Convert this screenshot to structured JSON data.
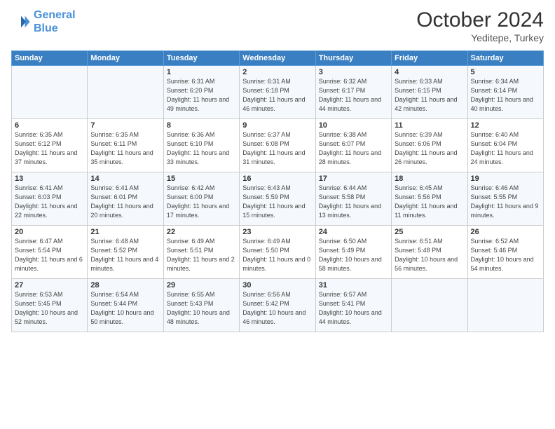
{
  "logo": {
    "line1": "General",
    "line2": "Blue"
  },
  "title": "October 2024",
  "location": "Yeditepe, Turkey",
  "days_header": [
    "Sunday",
    "Monday",
    "Tuesday",
    "Wednesday",
    "Thursday",
    "Friday",
    "Saturday"
  ],
  "weeks": [
    [
      {
        "num": "",
        "info": ""
      },
      {
        "num": "",
        "info": ""
      },
      {
        "num": "1",
        "info": "Sunrise: 6:31 AM\nSunset: 6:20 PM\nDaylight: 11 hours\nand 49 minutes."
      },
      {
        "num": "2",
        "info": "Sunrise: 6:31 AM\nSunset: 6:18 PM\nDaylight: 11 hours\nand 46 minutes."
      },
      {
        "num": "3",
        "info": "Sunrise: 6:32 AM\nSunset: 6:17 PM\nDaylight: 11 hours\nand 44 minutes."
      },
      {
        "num": "4",
        "info": "Sunrise: 6:33 AM\nSunset: 6:15 PM\nDaylight: 11 hours\nand 42 minutes."
      },
      {
        "num": "5",
        "info": "Sunrise: 6:34 AM\nSunset: 6:14 PM\nDaylight: 11 hours\nand 40 minutes."
      }
    ],
    [
      {
        "num": "6",
        "info": "Sunrise: 6:35 AM\nSunset: 6:12 PM\nDaylight: 11 hours\nand 37 minutes."
      },
      {
        "num": "7",
        "info": "Sunrise: 6:35 AM\nSunset: 6:11 PM\nDaylight: 11 hours\nand 35 minutes."
      },
      {
        "num": "8",
        "info": "Sunrise: 6:36 AM\nSunset: 6:10 PM\nDaylight: 11 hours\nand 33 minutes."
      },
      {
        "num": "9",
        "info": "Sunrise: 6:37 AM\nSunset: 6:08 PM\nDaylight: 11 hours\nand 31 minutes."
      },
      {
        "num": "10",
        "info": "Sunrise: 6:38 AM\nSunset: 6:07 PM\nDaylight: 11 hours\nand 28 minutes."
      },
      {
        "num": "11",
        "info": "Sunrise: 6:39 AM\nSunset: 6:06 PM\nDaylight: 11 hours\nand 26 minutes."
      },
      {
        "num": "12",
        "info": "Sunrise: 6:40 AM\nSunset: 6:04 PM\nDaylight: 11 hours\nand 24 minutes."
      }
    ],
    [
      {
        "num": "13",
        "info": "Sunrise: 6:41 AM\nSunset: 6:03 PM\nDaylight: 11 hours\nand 22 minutes."
      },
      {
        "num": "14",
        "info": "Sunrise: 6:41 AM\nSunset: 6:01 PM\nDaylight: 11 hours\nand 20 minutes."
      },
      {
        "num": "15",
        "info": "Sunrise: 6:42 AM\nSunset: 6:00 PM\nDaylight: 11 hours\nand 17 minutes."
      },
      {
        "num": "16",
        "info": "Sunrise: 6:43 AM\nSunset: 5:59 PM\nDaylight: 11 hours\nand 15 minutes."
      },
      {
        "num": "17",
        "info": "Sunrise: 6:44 AM\nSunset: 5:58 PM\nDaylight: 11 hours\nand 13 minutes."
      },
      {
        "num": "18",
        "info": "Sunrise: 6:45 AM\nSunset: 5:56 PM\nDaylight: 11 hours\nand 11 minutes."
      },
      {
        "num": "19",
        "info": "Sunrise: 6:46 AM\nSunset: 5:55 PM\nDaylight: 11 hours\nand 9 minutes."
      }
    ],
    [
      {
        "num": "20",
        "info": "Sunrise: 6:47 AM\nSunset: 5:54 PM\nDaylight: 11 hours\nand 6 minutes."
      },
      {
        "num": "21",
        "info": "Sunrise: 6:48 AM\nSunset: 5:52 PM\nDaylight: 11 hours\nand 4 minutes."
      },
      {
        "num": "22",
        "info": "Sunrise: 6:49 AM\nSunset: 5:51 PM\nDaylight: 11 hours\nand 2 minutes."
      },
      {
        "num": "23",
        "info": "Sunrise: 6:49 AM\nSunset: 5:50 PM\nDaylight: 11 hours\nand 0 minutes."
      },
      {
        "num": "24",
        "info": "Sunrise: 6:50 AM\nSunset: 5:49 PM\nDaylight: 10 hours\nand 58 minutes."
      },
      {
        "num": "25",
        "info": "Sunrise: 6:51 AM\nSunset: 5:48 PM\nDaylight: 10 hours\nand 56 minutes."
      },
      {
        "num": "26",
        "info": "Sunrise: 6:52 AM\nSunset: 5:46 PM\nDaylight: 10 hours\nand 54 minutes."
      }
    ],
    [
      {
        "num": "27",
        "info": "Sunrise: 6:53 AM\nSunset: 5:45 PM\nDaylight: 10 hours\nand 52 minutes."
      },
      {
        "num": "28",
        "info": "Sunrise: 6:54 AM\nSunset: 5:44 PM\nDaylight: 10 hours\nand 50 minutes."
      },
      {
        "num": "29",
        "info": "Sunrise: 6:55 AM\nSunset: 5:43 PM\nDaylight: 10 hours\nand 48 minutes."
      },
      {
        "num": "30",
        "info": "Sunrise: 6:56 AM\nSunset: 5:42 PM\nDaylight: 10 hours\nand 46 minutes."
      },
      {
        "num": "31",
        "info": "Sunrise: 6:57 AM\nSunset: 5:41 PM\nDaylight: 10 hours\nand 44 minutes."
      },
      {
        "num": "",
        "info": ""
      },
      {
        "num": "",
        "info": ""
      }
    ]
  ]
}
